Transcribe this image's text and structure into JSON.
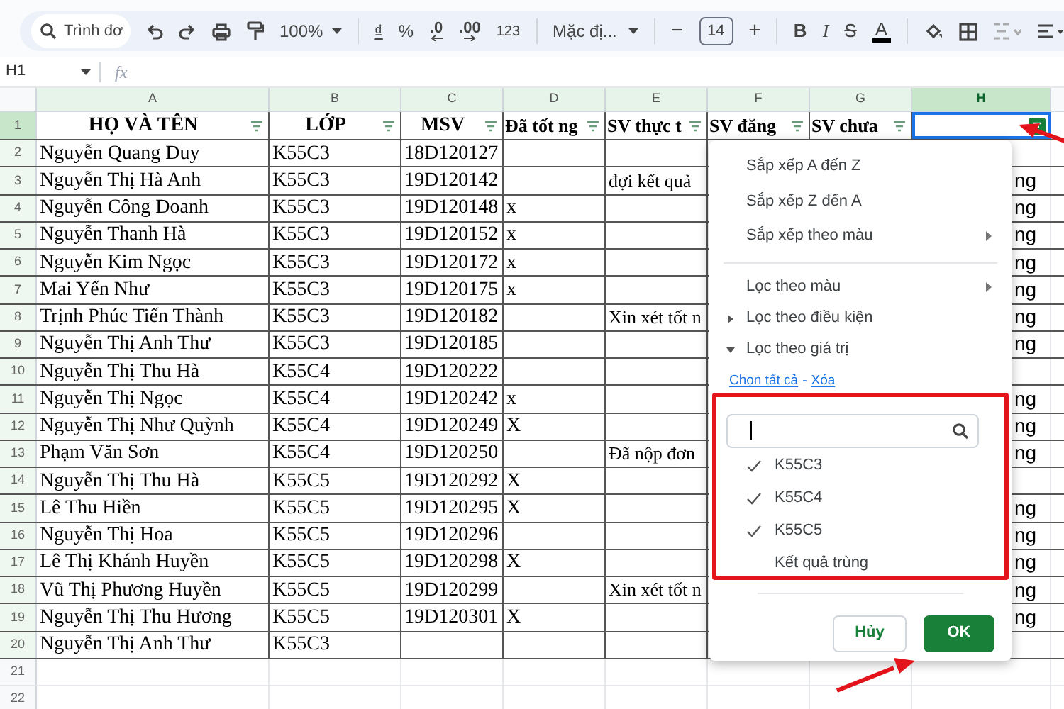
{
  "toolbar": {
    "search_placeholder": "Trình đơ",
    "zoom": "100%",
    "currency": "₫",
    "percent": "%",
    "decimal_less": ".0",
    "decimal_more": ".00",
    "number_format": "123",
    "font": "Mặc đị...",
    "font_size": "14",
    "minus": "−",
    "plus": "+",
    "bold": "B",
    "italic": "I",
    "strikethrough": "S",
    "text_color": "A"
  },
  "formula_bar": {
    "cell_ref": "H1",
    "fx": "fx"
  },
  "sheet": {
    "columns": [
      {
        "letter": "A",
        "selected": false
      },
      {
        "letter": "B",
        "selected": false
      },
      {
        "letter": "C",
        "selected": false
      },
      {
        "letter": "D",
        "selected": false
      },
      {
        "letter": "E",
        "selected": false
      },
      {
        "letter": "F",
        "selected": false
      },
      {
        "letter": "G",
        "selected": false
      },
      {
        "letter": "H",
        "selected": true
      }
    ],
    "header": {
      "row": "1",
      "cells": [
        {
          "text": "HỌ VÀ TÊN",
          "filter_active": false,
          "selected": false
        },
        {
          "text": "LỚP",
          "filter_active": false,
          "selected": false
        },
        {
          "text": "MSV",
          "filter_active": false,
          "selected": false
        },
        {
          "text": "Đã tốt ng",
          "filter_active": false,
          "selected": false
        },
        {
          "text": "SV thực t",
          "filter_active": false,
          "selected": false
        },
        {
          "text": "SV đăng",
          "filter_active": false,
          "selected": false
        },
        {
          "text": "SV chưa",
          "filter_active": false,
          "selected": false
        },
        {
          "filter_active": true,
          "selected": true
        }
      ]
    },
    "rows": [
      {
        "row": "2",
        "cells": {
          "A": "Nguyễn Quang Duy",
          "B": "K55C3",
          "C": "18D120127"
        }
      },
      {
        "row": "3",
        "cells": {
          "A": "Nguyễn Thị Hà Anh",
          "B": "K55C3",
          "C": "19D120142",
          "E": "đợi kết quả",
          "H": "ng"
        }
      },
      {
        "row": "4",
        "cells": {
          "A": "Nguyễn Công Doanh",
          "B": "K55C3",
          "C": "19D120148",
          "D": "x",
          "H": "ng"
        }
      },
      {
        "row": "5",
        "cells": {
          "A": "Nguyễn Thanh Hà",
          "B": "K55C3",
          "C": "19D120152",
          "D": "x",
          "H": "ng"
        }
      },
      {
        "row": "6",
        "cells": {
          "A": "Nguyễn Kim Ngọc",
          "B": "K55C3",
          "C": "19D120172",
          "D": "x",
          "H": "ng"
        }
      },
      {
        "row": "7",
        "cells": {
          "A": "Mai Yến Như",
          "B": "K55C3",
          "C": "19D120175",
          "D": "x",
          "H": "ng"
        }
      },
      {
        "row": "8",
        "cells": {
          "A": "Trịnh Phúc Tiến Thành",
          "B": "K55C3",
          "C": "19D120182",
          "E": "Xin xét tốt n",
          "H": "ng"
        }
      },
      {
        "row": "9",
        "cells": {
          "A": "Nguyễn Thị Anh Thư",
          "B": "K55C3",
          "C": "19D120185",
          "H": "ng"
        }
      },
      {
        "row": "10",
        "cells": {
          "A": "Nguyễn Thị Thu Hà",
          "B": "K55C4",
          "C": "19D120222"
        }
      },
      {
        "row": "11",
        "cells": {
          "A": "Nguyễn Thị Ngọc",
          "B": "K55C4",
          "C": "19D120242",
          "D": "x",
          "H": "ng"
        }
      },
      {
        "row": "12",
        "cells": {
          "A": "Nguyễn Thị Như Quỳnh",
          "B": "K55C4",
          "C": "19D120249",
          "D": "X",
          "H": "ng"
        }
      },
      {
        "row": "13",
        "cells": {
          "A": "Phạm Văn Sơn",
          "B": "K55C4",
          "C": "19D120250",
          "E": "Đã nộp đơn",
          "H": "ng"
        }
      },
      {
        "row": "14",
        "cells": {
          "A": "Nguyễn Thị Thu Hà",
          "B": "K55C5",
          "C": "19D120292",
          "D": "X"
        }
      },
      {
        "row": "15",
        "cells": {
          "A": "Lê Thu Hiền",
          "B": "K55C5",
          "C": "19D120295",
          "D": "X",
          "H": "ng"
        }
      },
      {
        "row": "16",
        "cells": {
          "A": "Nguyễn Thị Hoa",
          "B": "K55C5",
          "C": "19D120296",
          "H": "ng"
        }
      },
      {
        "row": "17",
        "cells": {
          "A": "Lê Thị Khánh Huyền",
          "B": "K55C5",
          "C": "19D120298",
          "D": "X",
          "H": "ng"
        }
      },
      {
        "row": "18",
        "cells": {
          "A": "Vũ Thị Phương Huyền",
          "B": "K55C5",
          "C": "19D120299",
          "E": "Xin xét tốt n",
          "H": "ng"
        }
      },
      {
        "row": "19",
        "cells": {
          "A": "Nguyễn Thị Thu Hương",
          "B": "K55C5",
          "C": "19D120301",
          "D": "X",
          "H": "ng"
        }
      },
      {
        "row": "20",
        "cells": {
          "A": "Nguyễn Thị Anh Thư",
          "B": "K55C3"
        }
      },
      {
        "row": "21",
        "cells": {}
      },
      {
        "row": "22",
        "cells": {}
      }
    ]
  },
  "filter_menu": {
    "sort_items": [
      {
        "label": "Sắp xếp A đến Z",
        "submenu": false
      },
      {
        "label": "Sắp xếp Z đến A",
        "submenu": false
      },
      {
        "label": "Sắp xếp theo màu",
        "submenu": true
      }
    ],
    "filter_sections": [
      {
        "label": "Lọc theo màu",
        "kind": "submenu"
      },
      {
        "label": "Lọc theo điều kiện",
        "kind": "collapsed"
      },
      {
        "label": "Lọc theo giá trị",
        "kind": "expanded"
      }
    ],
    "select_all": "Chọn tất cả",
    "separator": "-",
    "clear": "Xóa",
    "values": [
      {
        "label": "K55C3",
        "checked": true
      },
      {
        "label": "K55C4",
        "checked": true
      },
      {
        "label": "K55C5",
        "checked": true
      },
      {
        "label": "Kết quả trùng",
        "checked": false
      }
    ],
    "cancel_button": "Hủy",
    "ok_button": "OK"
  }
}
